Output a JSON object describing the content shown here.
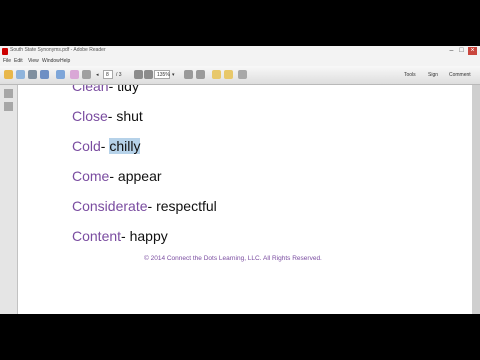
{
  "window": {
    "title": "South State Synonyms.pdf - Adobe Reader"
  },
  "menu": [
    "File",
    "Edit",
    "View",
    "Window",
    "Help"
  ],
  "toolbar": {
    "page_current": "8",
    "page_total": "/ 3",
    "zoom": "135%",
    "tools": "Tools",
    "sign": "Sign",
    "comment": "Comment"
  },
  "entries": [
    {
      "word": "Clean",
      "def": "tidy"
    },
    {
      "word": "Close",
      "def": "shut"
    },
    {
      "word": "Cold",
      "def": "chilly"
    },
    {
      "word": "Come",
      "def": "appear"
    },
    {
      "word": "Considerate",
      "def": "respectful"
    },
    {
      "word": "Content",
      "def": "happy"
    }
  ],
  "footer": "© 2014 Connect the Dots Learning, LLC. All Rights Reserved.",
  "colors": {
    "accent_word": "#7a4ca0",
    "highlight": "#b6d2e9"
  }
}
